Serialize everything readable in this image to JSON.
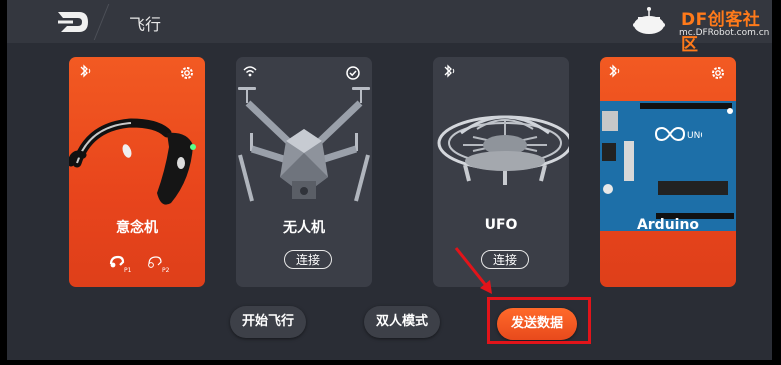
{
  "header": {
    "title": "飞行",
    "brand_name": "DF创客社区",
    "brand_url": "mc.DFRobot.com.cn"
  },
  "cards": [
    {
      "label": "意念机",
      "extra": [
        "P1",
        "P2"
      ]
    },
    {
      "label": "无人机",
      "connect": "连接"
    },
    {
      "label": "UFO",
      "connect": "连接"
    },
    {
      "label": "Arduino"
    }
  ],
  "buttons": {
    "start_flight": "开始飞行",
    "two_player": "双人模式",
    "send_data": "发送数据"
  },
  "colors": {
    "accent": "#e8451c",
    "card_dark": "#3b3e47",
    "highlight": "#e2141a"
  }
}
